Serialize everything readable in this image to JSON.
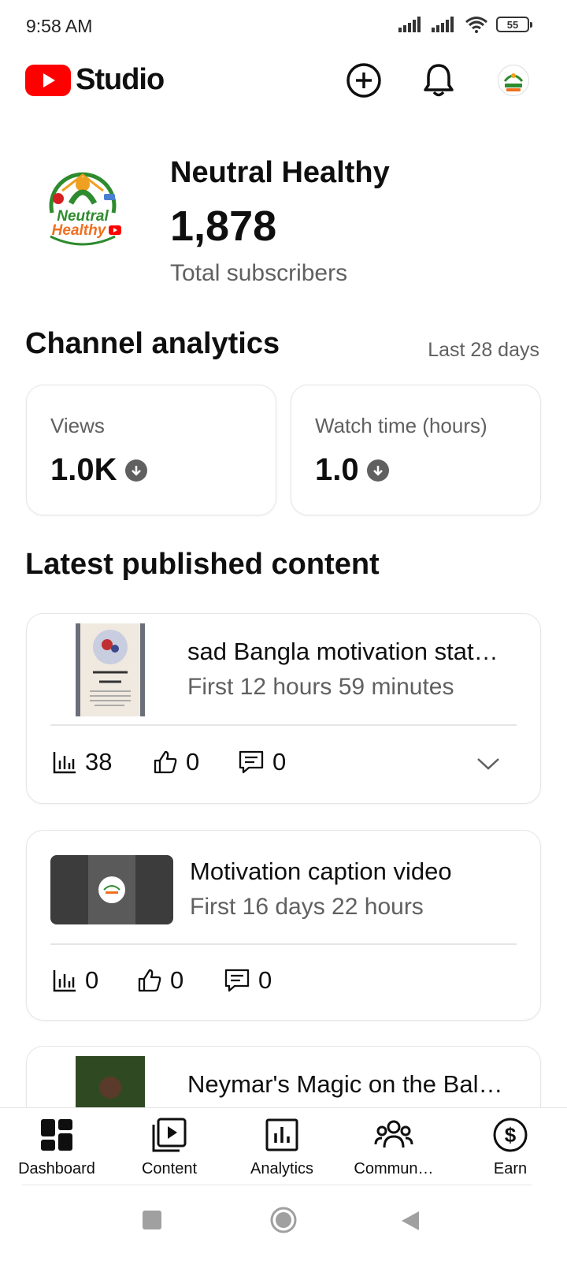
{
  "status_bar": {
    "time": "9:58 AM",
    "battery": "55"
  },
  "header": {
    "app_name": "Studio"
  },
  "channel": {
    "name": "Neutral Healthy",
    "subscribers": "1,878",
    "subscribers_label": "Total subscribers",
    "logo_line1": "Neutral",
    "logo_line2": "Healthy"
  },
  "analytics": {
    "title": "Channel analytics",
    "range": "Last 28 days",
    "metrics": [
      {
        "label": "Views",
        "value": "1.0K"
      },
      {
        "label": "Watch time (hours)",
        "value": "1.0"
      }
    ]
  },
  "latest": {
    "title": "Latest published content",
    "items": [
      {
        "title": "sad Bangla motivation stat…",
        "subtitle": "First 12 hours 59 minutes",
        "views": "38",
        "likes": "0",
        "comments": "0"
      },
      {
        "title": "Motivation caption video",
        "subtitle": "First 16 days 22 hours",
        "views": "0",
        "likes": "0",
        "comments": "0"
      },
      {
        "title": "Neymar's Magic on the Bal…"
      }
    ]
  },
  "bottom_nav": [
    "Dashboard",
    "Content",
    "Analytics",
    "Commun…",
    "Earn"
  ],
  "colors": {
    "youtube_red": "#ff0000",
    "text_primary": "#0f0f0f",
    "text_secondary": "#606060"
  }
}
